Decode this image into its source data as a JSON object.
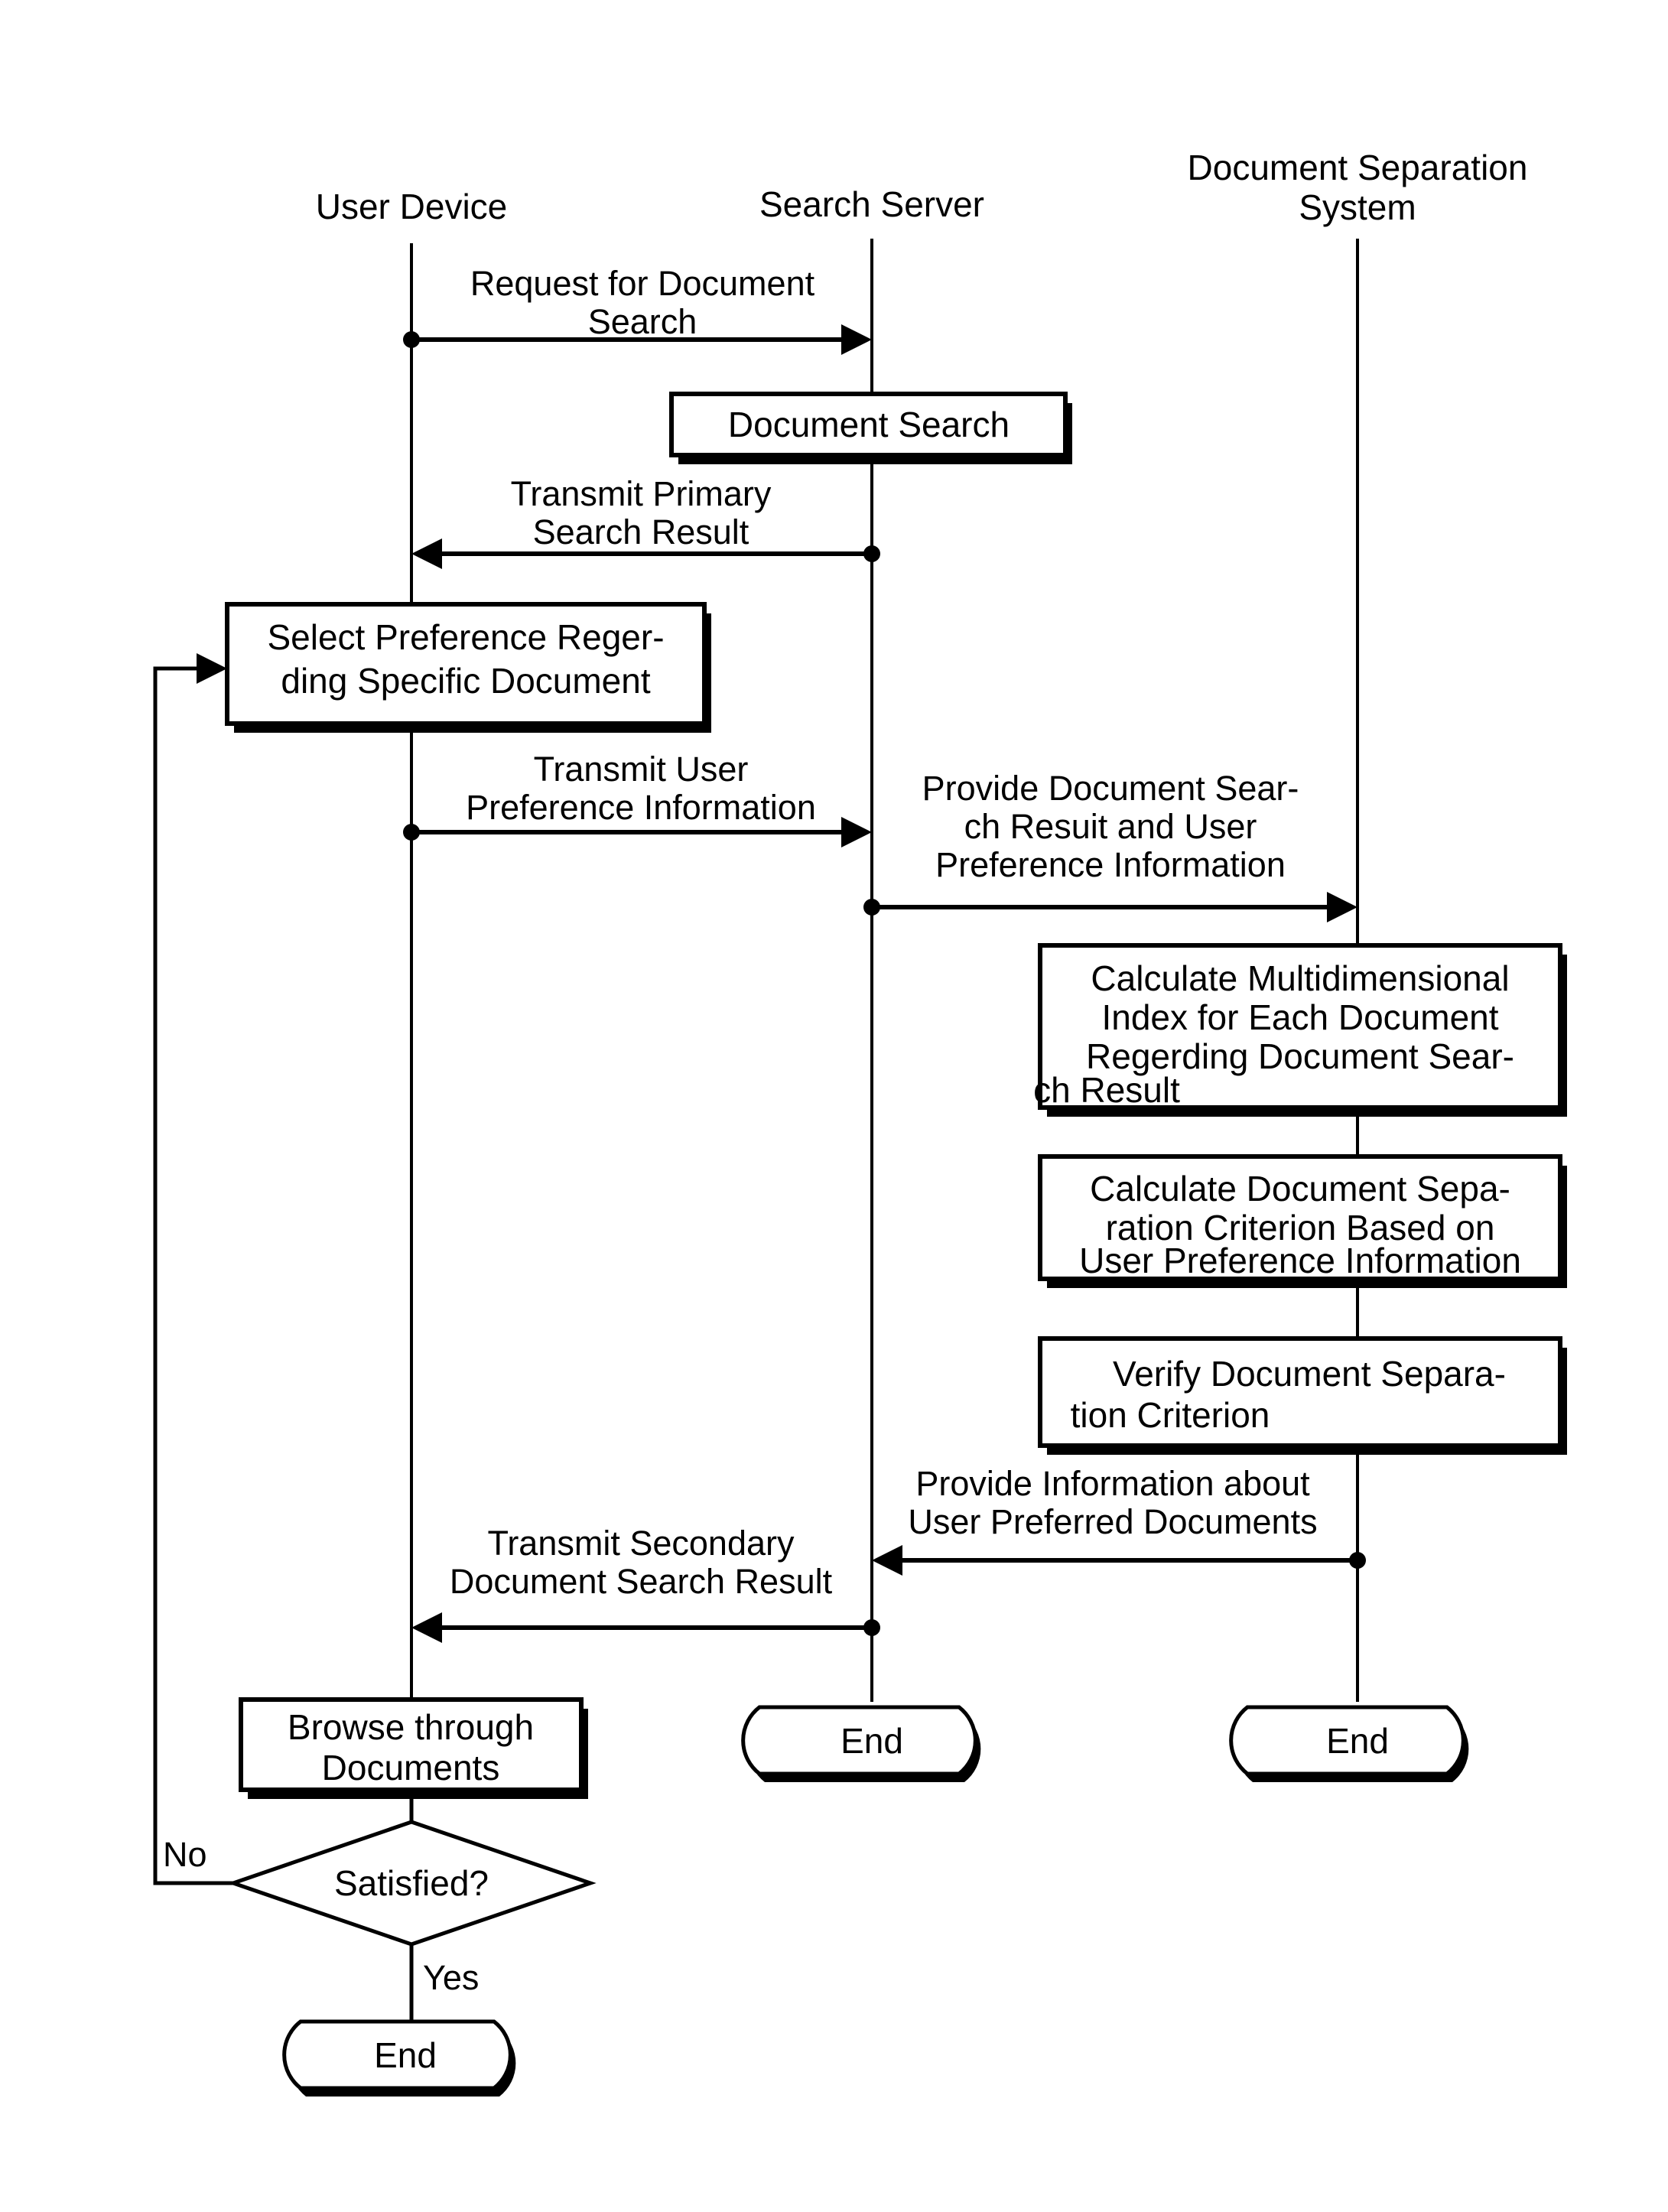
{
  "diagram": {
    "type": "sequence-flowchart",
    "background_color": "#ffffff",
    "line_color": "#000000",
    "lanes": [
      {
        "id": "user-device",
        "title": "User Device"
      },
      {
        "id": "search-server",
        "title": "Search Server"
      },
      {
        "id": "document-separation-system",
        "title_line1": "Document Separation",
        "title_line2": "System"
      }
    ],
    "messages": [
      {
        "id": "request-for-document-search",
        "line1": "Request for Document",
        "line2": "Search",
        "from": "user-device",
        "to": "search-server",
        "direction": "right"
      },
      {
        "id": "transmit-primary-search-result",
        "line1": "Transmit Primary",
        "line2": "Search Result",
        "from": "search-server",
        "to": "user-device",
        "direction": "left"
      },
      {
        "id": "transmit-user-preference-information",
        "line1": "Transmit User",
        "line2": "Preference Information",
        "from": "user-device",
        "to": "search-server",
        "direction": "right"
      },
      {
        "id": "provide-document-search-result-and-user-preference-information",
        "line1": "Provide Document Sear-",
        "line2": "ch Resuit and User",
        "line3": "Preference Information",
        "from": "search-server",
        "to": "document-separation-system",
        "direction": "right"
      },
      {
        "id": "provide-information-about-user-preferred-documents",
        "line1": "Provide Information about",
        "line2": "User Preferred Documents",
        "from": "document-separation-system",
        "to": "search-server",
        "direction": "left"
      },
      {
        "id": "transmit-secondary-document-search-result",
        "line1": "Transmit Secondary",
        "line2": "Document Search Result",
        "from": "search-server",
        "to": "user-device",
        "direction": "left"
      }
    ],
    "process_boxes": [
      {
        "id": "document-search",
        "lane": "search-server",
        "lines": [
          "Document Search"
        ]
      },
      {
        "id": "select-preference-regerding-specific-document",
        "lane": "user-device",
        "lines": [
          "Select Preference Reger-",
          "ding Specific Document"
        ]
      },
      {
        "id": "calculate-multidimensional-index",
        "lane": "document-separation-system",
        "lines": [
          "Calculate Multidimensional",
          "Index for Each Document",
          "Regerding Document Sear-",
          "ch Result"
        ]
      },
      {
        "id": "calculate-document-separation-criterion",
        "lane": "document-separation-system",
        "lines": [
          "Calculate Document Sepa-",
          "ration  Criterion Based on",
          "User Preference Information"
        ]
      },
      {
        "id": "verify-document-separation-criterion",
        "lane": "document-separation-system",
        "lines": [
          "Verify Document Separa-",
          "tion Criterion"
        ]
      },
      {
        "id": "browse-through-documents",
        "lane": "user-device",
        "lines": [
          "Browse through",
          "Documents"
        ]
      }
    ],
    "decision": {
      "id": "satisfied",
      "label": "Satisfied?",
      "branch_no": "No",
      "branch_yes": "Yes"
    },
    "terminators": [
      {
        "id": "end-search-server",
        "label": "End",
        "lane": "search-server"
      },
      {
        "id": "end-document-separation-system",
        "label": "End",
        "lane": "document-separation-system"
      },
      {
        "id": "end-user-device",
        "label": "End",
        "lane": "user-device"
      }
    ]
  }
}
